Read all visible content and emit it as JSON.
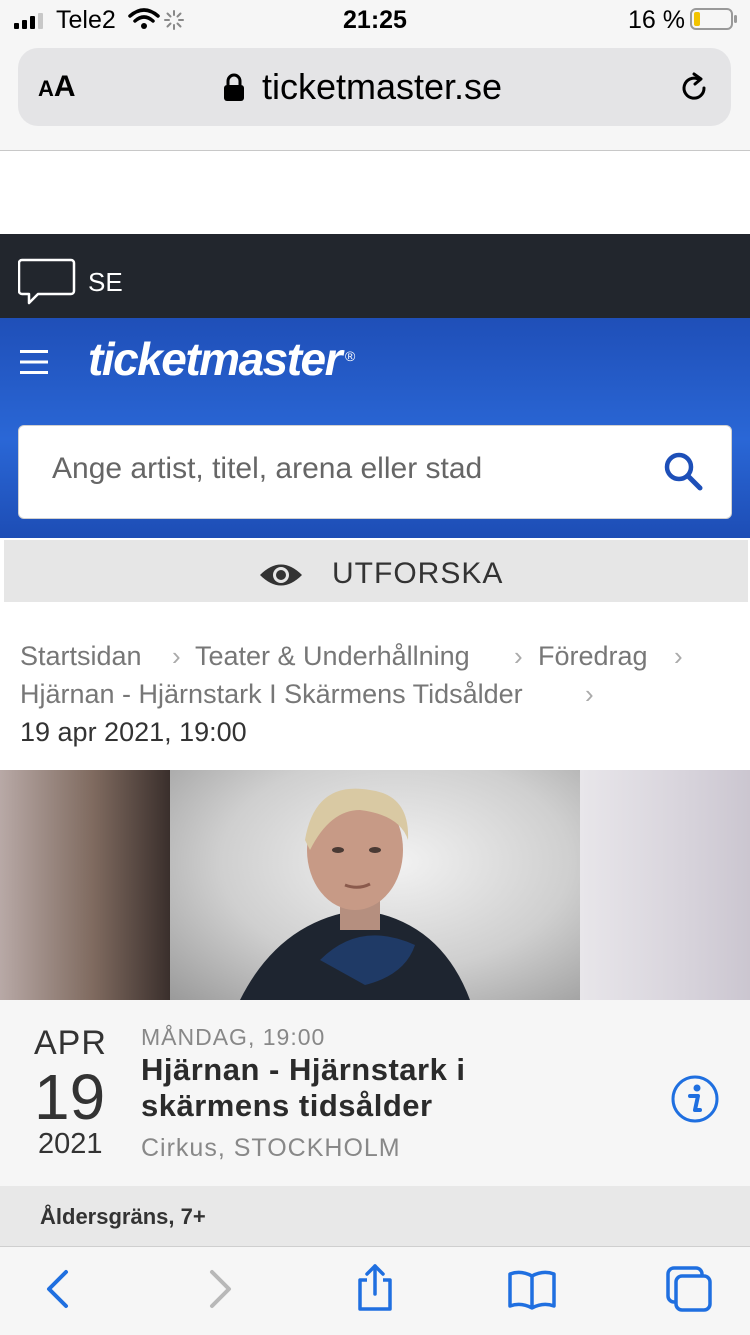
{
  "status_bar": {
    "carrier": "Tele2",
    "time": "21:25",
    "battery_percent": "16 %",
    "battery_level": 0.16
  },
  "browser": {
    "text_size_label_small": "A",
    "text_size_label_large": "A",
    "domain": "ticketmaster.se"
  },
  "header": {
    "language": "SE",
    "logo": "ticketmaster",
    "logo_mark": "®",
    "search_placeholder": "Ange artist, titel, arena eller stad"
  },
  "explore": {
    "label": "UTFORSKA"
  },
  "breadcrumb": {
    "items": [
      "Startsidan",
      "Teater & Underhållning",
      "Föredrag",
      "Hjärnan - Hjärnstark I Skärmens Tidsålder"
    ],
    "separator": "›",
    "date": "19 apr 2021, 19:00"
  },
  "event": {
    "month": "APR",
    "day": "19",
    "year": "2021",
    "weekday_time": "MÅNDAG, 19:00",
    "title_line1": "Hjärnan - Hjärnstark i",
    "title_line2": "skärmens tidsålder",
    "venue": "Cirkus, STOCKHOLM",
    "age_limit": "Åldersgräns, 7+"
  },
  "colors": {
    "brand_blue": "#2a67d6",
    "dark_header": "#22262d",
    "ios_blue": "#1f6fe0"
  },
  "icons": {
    "menu": "hamburger-icon",
    "search": "search-icon",
    "explore": "eye-icon",
    "info": "info-icon",
    "chat": "chat-bubble-icon"
  }
}
